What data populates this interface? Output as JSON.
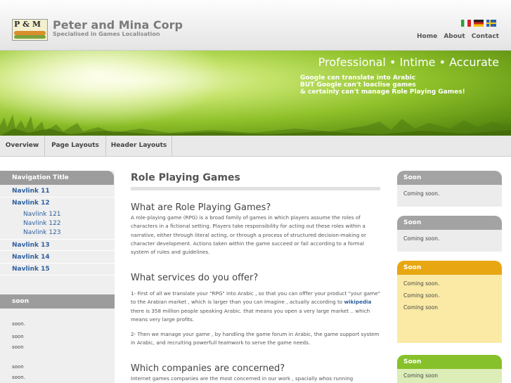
{
  "header": {
    "logo_text": "P & M",
    "company": "Peter and Mina Corp",
    "tagline": "Specialised in Games Localisation",
    "flags": [
      "flag-italy-icon",
      "flag-germany-icon",
      "flag-sweden-icon"
    ],
    "links": [
      "Home",
      "About",
      "Contact"
    ]
  },
  "banner": {
    "slogan": "Professional • Intime • Accurate",
    "lines": [
      "Google can translate into Arabic",
      "BUT Google can't loaclise games",
      "& certainly can't manage Role Playing Games!"
    ]
  },
  "nav": {
    "tabs": [
      "Overview",
      "Page Layouts",
      "Header Layouts"
    ]
  },
  "sidebar": {
    "title": "Navigation Title",
    "links": [
      {
        "label": "Navlink 11",
        "level": 1
      },
      {
        "label": "Navlink 12",
        "level": 1
      },
      {
        "label": "Navlink 121",
        "level": 2
      },
      {
        "label": "Navlink 122",
        "level": 2
      },
      {
        "label": "Navlink 123",
        "level": 2
      },
      {
        "label": "Navlink 13",
        "level": 1
      },
      {
        "label": "Navlink 14",
        "level": 1
      },
      {
        "label": "Navlink 15",
        "level": 1
      }
    ],
    "soon_title": "soon",
    "soon_items": [
      "soon.",
      "soon",
      "soon",
      "soon",
      "soon."
    ]
  },
  "main": {
    "title": "Role Playing Games",
    "sections": [
      {
        "heading": "What are Role Playing Games?",
        "paragraphs": [
          {
            "text": "A role-playing game (RPG) is a broad family of games in which players assume the roles of characters in a fictional setting. Players take responsibility for acting out these roles within a narrative, either through literal acting, or through a process of structured decision-making or character development. Actions taken within the game succeed or fail according to a formal system of rules and guidelines."
          }
        ]
      },
      {
        "heading": "What services do you offer?",
        "paragraphs": [
          {
            "before": "1- First of all we translate your \"RPG\" into Arabic , so that you can offfer your product \"your game\" to the Arabian market , which is larger than you can imagine , actually according to ",
            "link": "wikipedia",
            "after": " there is 358 million people speaking Arabic. that means you open a very large market .. which means very large profits."
          },
          {
            "text": "2- Then we manage your game , by handling the game forum in Arabic, the game support system in Arabic, and recruiting powerfull teamwork to serve the game needs."
          }
        ]
      },
      {
        "heading": "Which companies are concerned?",
        "paragraphs": [
          {
            "text": "Internet games companies are the most concerned in our work , spacially whos running"
          }
        ]
      }
    ]
  },
  "right_boxes": [
    {
      "title": "Soon",
      "items": [
        "Coming soon."
      ],
      "head_color": "#a3a3a3",
      "body_color": "#ececec"
    },
    {
      "title": "Soon",
      "items": [
        "Coming soon."
      ],
      "head_color": "#a3a3a3",
      "body_color": "#ececec"
    },
    {
      "title": "Soon",
      "items": [
        "Coming soon.",
        "Coming soon.",
        "Coming soon"
      ],
      "head_color": "#e8a712",
      "body_color": "#faeaa6"
    },
    {
      "title": "Soon",
      "items": [
        "Coming soon"
      ],
      "head_color": "#86c12b",
      "body_color": "#dcedb8"
    }
  ]
}
